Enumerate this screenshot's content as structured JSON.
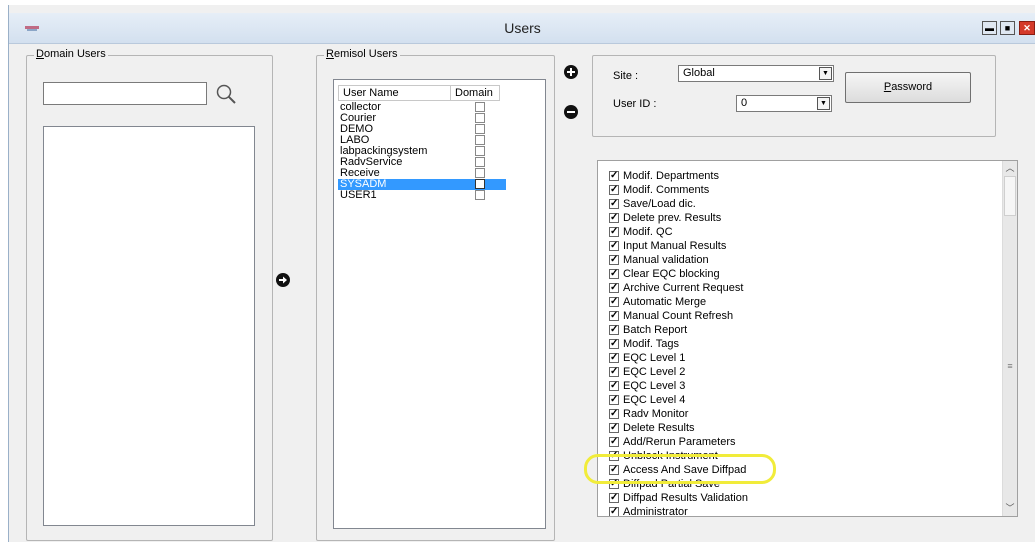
{
  "window": {
    "title": "Users"
  },
  "domain_users": {
    "legend_prefix": "D",
    "legend_rest": "omain Users",
    "search_value": ""
  },
  "remisol_users": {
    "legend_prefix": "R",
    "legend_rest": "emisol Users",
    "columns": [
      "User Name",
      "Domain"
    ],
    "rows": [
      {
        "name": "collector",
        "domain": false
      },
      {
        "name": "Courier",
        "domain": false
      },
      {
        "name": "DEMO",
        "domain": false
      },
      {
        "name": "LABO",
        "domain": false
      },
      {
        "name": "labpackingsystem",
        "domain": false
      },
      {
        "name": "RadvService",
        "domain": false
      },
      {
        "name": "Receive",
        "domain": false
      },
      {
        "name": "SYSADM",
        "domain": false,
        "selected": true
      },
      {
        "name": "USER1",
        "domain": false
      }
    ]
  },
  "site": {
    "label": "Site :",
    "value": "Global"
  },
  "user_id": {
    "label": "User ID :",
    "value": "0"
  },
  "password_button": {
    "prefix": "P",
    "rest": "assword"
  },
  "permissions": [
    "Modif. Departments",
    "Modif. Comments",
    "Save/Load dic.",
    "Delete prev. Results",
    "Modif. QC",
    "Input Manual Results",
    "Manual validation",
    "Clear EQC blocking",
    "Archive Current Request",
    "Automatic Merge",
    "Manual Count Refresh",
    "Batch Report",
    "Modif. Tags",
    "EQC Level 1",
    "EQC Level 2",
    "EQC Level 3",
    "EQC Level 4",
    "Radv Monitor",
    "Delete Results",
    "Add/Rerun Parameters",
    "Unblock Instrument",
    "Access And Save Diffpad",
    "Diffpad Partial Save",
    "Diffpad Results Validation",
    "Administrator"
  ],
  "colors": {
    "highlight": "#f1ec3a",
    "selection": "#3399ff"
  }
}
